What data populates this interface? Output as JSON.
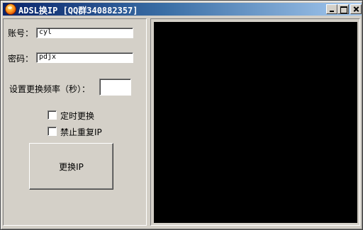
{
  "window": {
    "title": "ADSL换IP [QQ群340882357]",
    "icon": "app-orb-icon"
  },
  "titlebar_buttons": {
    "minimize_icon": "minimize-icon",
    "maximize_icon": "maximize-icon",
    "close_icon": "close-icon"
  },
  "form": {
    "account_label": "账号：",
    "account_value": "cyl",
    "password_label": "密码：",
    "password_value": "pdjx",
    "frequency_label": "设置更换频率（秒）：",
    "frequency_value": ""
  },
  "options": {
    "timed_change_label": "定时更换",
    "timed_change_checked": false,
    "no_repeat_ip_label": "禁止重复IP",
    "no_repeat_ip_checked": false
  },
  "actions": {
    "change_ip_label": "更换IP"
  },
  "colors": {
    "titlebar_start": "#0a246a",
    "titlebar_end": "#a6caf0",
    "window_face": "#d4d0c8",
    "display_background": "#000000"
  }
}
